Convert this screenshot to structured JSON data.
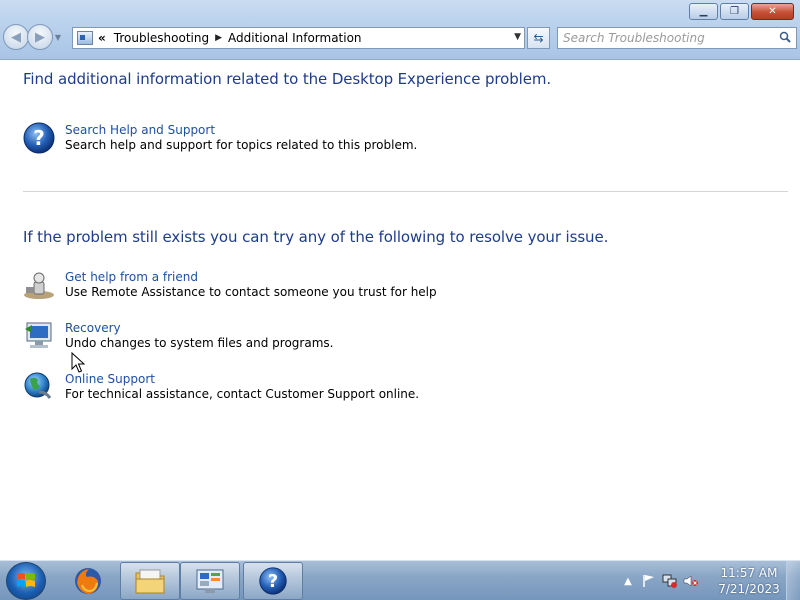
{
  "window": {
    "minimize_icon": "minimize-icon",
    "maximize_icon": "restore-icon",
    "close_icon": "close-icon"
  },
  "nav": {
    "back_icon": "back-arrow-icon",
    "forward_icon": "forward-arrow-icon",
    "history_icon": "chevron-down-icon"
  },
  "address": {
    "overflow": "«",
    "crumbs": [
      "Troubleshooting",
      "Additional Information"
    ],
    "refresh_icon": "refresh-icon"
  },
  "search": {
    "placeholder": "Search Troubleshooting"
  },
  "main": {
    "heading1": "Find additional information related to the Desktop Experience problem.",
    "help_task": {
      "link": "Search Help and Support",
      "desc": "Search help and support for topics related to this problem."
    },
    "heading2": "If the problem still exists you can try any of the following to resolve your issue.",
    "tasks": [
      {
        "link": "Get help from a friend",
        "desc": "Use Remote Assistance to contact someone you trust for help"
      },
      {
        "link": "Recovery",
        "desc": "Undo changes to system files and programs."
      },
      {
        "link": "Online Support",
        "desc": "For technical assistance, contact Customer Support online."
      }
    ]
  },
  "taskbar": {
    "clock_time": "11:57 AM",
    "clock_date": "7/21/2023",
    "colors": {
      "accent": "#1e3c8c",
      "link": "#1e4fa3"
    }
  }
}
